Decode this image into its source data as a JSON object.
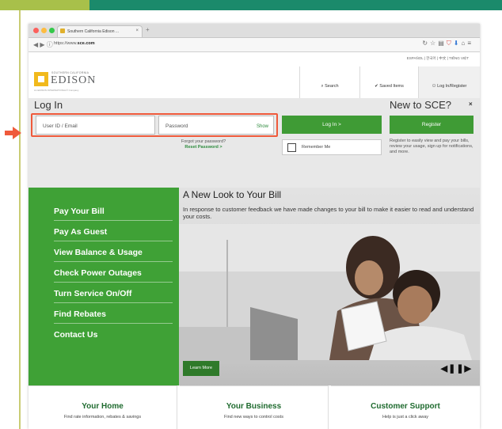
{
  "browser": {
    "tab_title": "Southern California Edison ...",
    "tab_close": "×",
    "new_tab": "+",
    "nav_arrows": "◀ ▶ ⓘ",
    "url_prefix": "https://www.",
    "url_domain": "sce.com",
    "icons": [
      "reload-icon",
      "star-icon",
      "bookmark-icon",
      "pocket-icon",
      "download-icon",
      "home-icon",
      "menu-icon"
    ]
  },
  "header": {
    "languages": "ESPAÑOL  |  한국어  |  中文  |  TIẾNG VIỆT",
    "logo_small": "SOUTHERN CALIFORNIA",
    "logo_text": "EDISON",
    "logo_tag": "An EDISON INTERNATIONAL® Company",
    "search": "Search",
    "saved_items": "Saved Items",
    "login_register": "Log In/Register"
  },
  "login": {
    "title": "Log In",
    "userid_placeholder": "User ID / Email",
    "password_placeholder": "Password",
    "show": "Show",
    "login_button": "Log In >",
    "forgot_text": "Forgot your password?",
    "reset_link": "Reset Password >",
    "remember_me": "Remember Me"
  },
  "register": {
    "title": "New to SCE?",
    "button": "Register",
    "description": "Register to easily view and pay your bills, review your usage, sign up for notifications, and more.",
    "close": "×"
  },
  "green_nav": [
    "Pay Your Bill",
    "Pay As Guest",
    "View Balance & Usage",
    "Check Power Outages",
    "Turn Service On/Off",
    "Find Rebates",
    "Contact Us"
  ],
  "bill": {
    "title": "A New Look to Your Bill",
    "text": "In response to customer feedback we have made changes to your bill to make it easier to read and understand your costs.",
    "learn_more": "Learn More",
    "carousel_controls": "◀❚❚▶"
  },
  "cards": [
    {
      "title": "Your Home",
      "desc": "Find rate information, rebates & savings"
    },
    {
      "title": "Your Business",
      "desc": "Find new ways to control costs"
    },
    {
      "title": "Customer Support",
      "desc": "Help is just a click away"
    }
  ],
  "colors": {
    "brand_green": "#3fa136",
    "annotation_orange": "#ef5a3b",
    "logo_yellow": "#f1b91c",
    "top_bar_green": "#1b8a6b"
  }
}
